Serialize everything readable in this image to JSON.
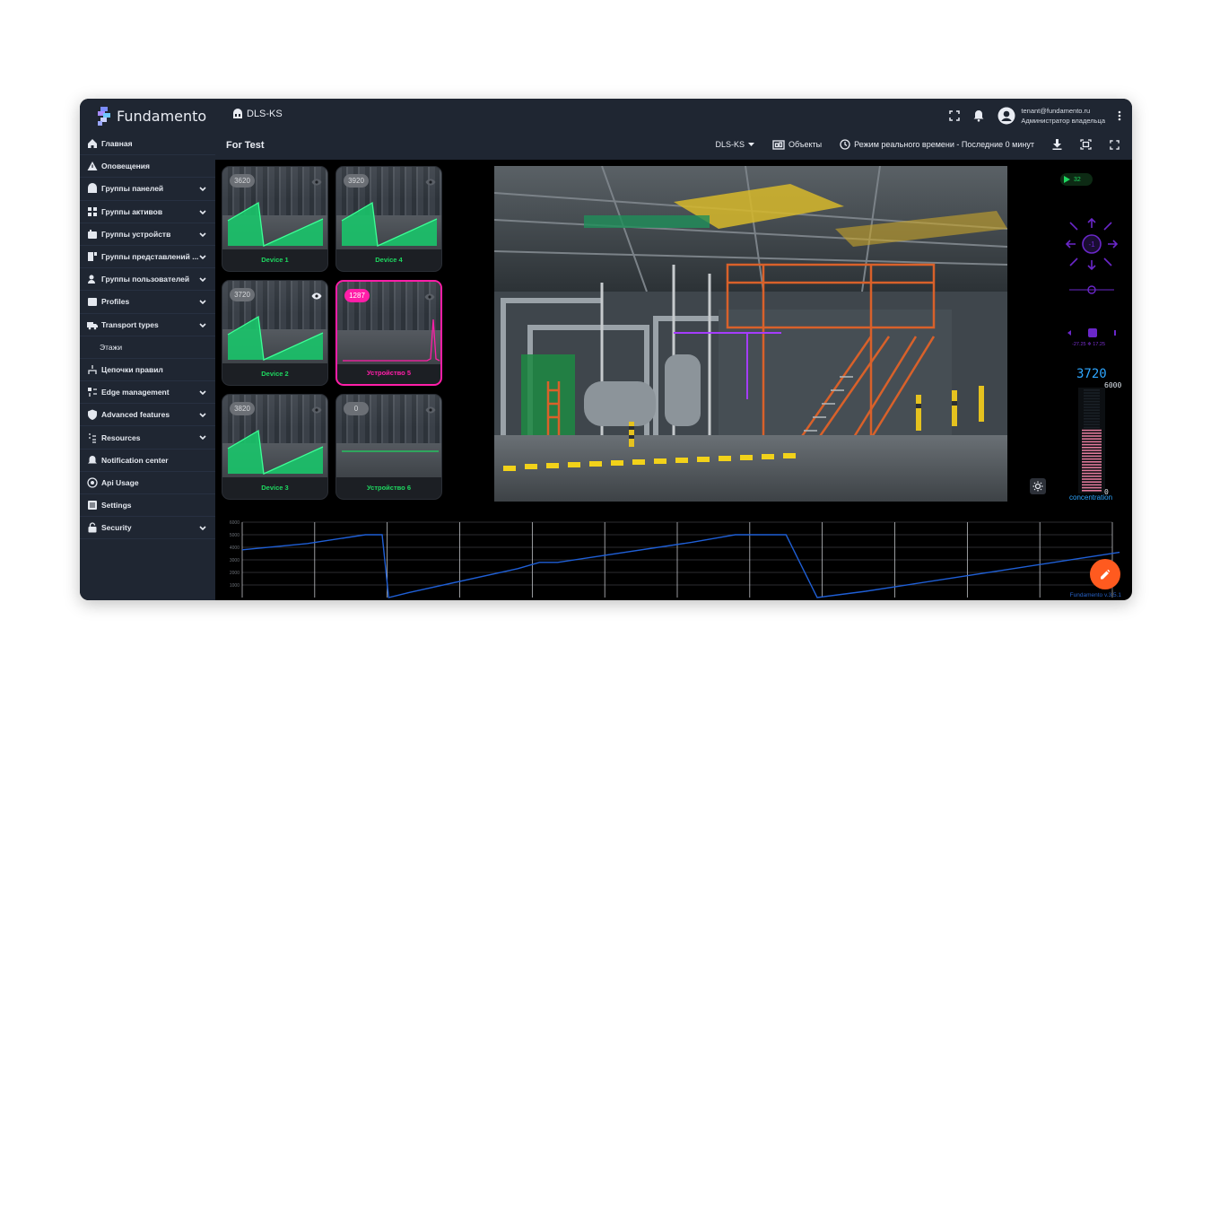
{
  "app": {
    "brand": "Fundamento",
    "breadcrumb": "DLS-KS",
    "user_email": "tenant@fundamento.ru",
    "user_role": "Администратор владельца"
  },
  "sidebar": {
    "items": [
      {
        "label": "Главная",
        "icon": "home-icon",
        "expandable": false
      },
      {
        "label": "Оповещения",
        "icon": "warning-icon",
        "expandable": false
      },
      {
        "label": "Группы панелей",
        "icon": "dashboard-icon",
        "expandable": true
      },
      {
        "label": "Группы активов",
        "icon": "assets-icon",
        "expandable": true
      },
      {
        "label": "Группы устройств",
        "icon": "devices-icon",
        "expandable": true
      },
      {
        "label": "Группы представлений ...",
        "icon": "views-icon",
        "expandable": true
      },
      {
        "label": "Группы пользователей",
        "icon": "users-icon",
        "expandable": true
      },
      {
        "label": "Profiles",
        "icon": "profiles-icon",
        "expandable": true
      },
      {
        "label": "Transport types",
        "icon": "truck-icon",
        "expandable": true
      },
      {
        "label": "Этажи",
        "icon": "",
        "expandable": false
      },
      {
        "label": "Цепочки правил",
        "icon": "rule-chain-icon",
        "expandable": false
      },
      {
        "label": "Edge management",
        "icon": "edge-icon",
        "expandable": true
      },
      {
        "label": "Advanced features",
        "icon": "shield-icon",
        "expandable": true
      },
      {
        "label": "Resources",
        "icon": "resources-icon",
        "expandable": true
      },
      {
        "label": "Notification center",
        "icon": "bell-icon",
        "expandable": false
      },
      {
        "label": "Api Usage",
        "icon": "api-icon",
        "expandable": false
      },
      {
        "label": "Settings",
        "icon": "settings-icon",
        "expandable": false
      },
      {
        "label": "Security",
        "icon": "lock-icon",
        "expandable": true
      }
    ]
  },
  "header": {
    "title": "For Test",
    "entity_selector": "DLS-KS",
    "objects_label": "Объекты",
    "time_label": "Режим реального времени - Последние 0 минут"
  },
  "devices": [
    {
      "name": "Device 1",
      "value": "3620",
      "alarm": false,
      "trend": "ramp"
    },
    {
      "name": "Device 4",
      "value": "3920",
      "alarm": false,
      "trend": "ramp"
    },
    {
      "name": "Device 2",
      "value": "3720",
      "alarm": false,
      "trend": "ramp"
    },
    {
      "name": "Устройство 5",
      "value": "1287",
      "alarm": true,
      "trend": "spike"
    },
    {
      "name": "Device 3",
      "value": "3820",
      "alarm": false,
      "trend": "ramp"
    },
    {
      "name": "Устройство 6",
      "value": "0",
      "alarm": false,
      "trend": "flat"
    }
  ],
  "right_panel": {
    "play_count": "32",
    "digital_value": "3720",
    "max_value": "6000",
    "min_value": "0",
    "label": "concentration",
    "mini_readout": "-27.25 ❄ 17.25"
  },
  "chart_data": {
    "type": "line",
    "ylim": [
      0,
      6000
    ],
    "y_ticks": [
      "6000",
      "5000",
      "4000",
      "3000",
      "2000",
      "1000"
    ],
    "series": [
      {
        "color": "#1f5fd6",
        "x": [
          0,
          0.9,
          1.7,
          1.93,
          2.02,
          2.3,
          3.8,
          4.1,
          4.35,
          6.2,
          6.6,
          6.8,
          7.2,
          7.5,
          7.93,
          8.6,
          12.1
        ],
        "values": [
          3800,
          4300,
          5000,
          5000,
          0,
          400,
          2300,
          2800,
          2800,
          4400,
          4800,
          5000,
          5000,
          5000,
          0,
          500,
          3600
        ]
      }
    ],
    "x_ticks": 12
  },
  "footer": {
    "version": "Fundamento v.3.5.1"
  },
  "colors": {
    "panel": "#1f2632",
    "ok_green": "#1ed760",
    "alarm_pink": "#ff1ea8",
    "line_blue": "#1f5fd6",
    "fab_orange": "#ff5a1f"
  }
}
